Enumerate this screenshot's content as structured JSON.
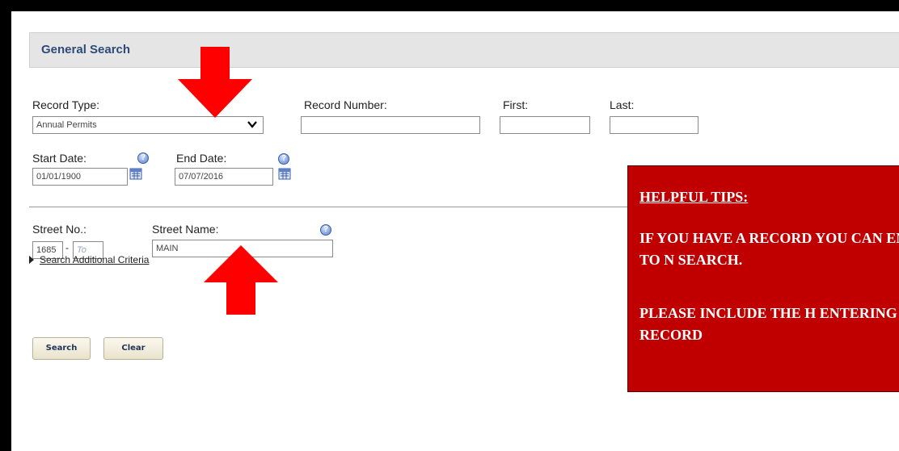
{
  "general_search": {
    "title": "General Search"
  },
  "record_type": {
    "label": "Record Type:",
    "value": "Annual Permits"
  },
  "record_number": {
    "label": "Record Number:",
    "value": ""
  },
  "first": {
    "label": "First:",
    "value": ""
  },
  "last": {
    "label": "Last:",
    "value": ""
  },
  "start_date": {
    "label": "Start Date:",
    "value": "01/01/1900"
  },
  "end_date": {
    "label": "End Date:",
    "value": "07/07/2016"
  },
  "street_no": {
    "label": "Street No.:",
    "from": "1685",
    "to_placeholder": "To",
    "separator": "-"
  },
  "street_name": {
    "label": "Street Name:",
    "value": "MAIN"
  },
  "additional": {
    "label": "Search Additional Criteria"
  },
  "buttons": {
    "search": "Search",
    "clear": "Clear"
  },
  "help_glyph": "?",
  "tips": {
    "title": "HELPFUL TIPS:",
    "p1": "IF YOU HAVE A RECORD YOU CAN ENTER IT TO N SEARCH.",
    "p2": "PLEASE INCLUDE THE H ENTERING THE RECORD"
  },
  "colors": {
    "header_text": "#2d4a78",
    "tips_bg": "#c00000",
    "arrow": "#ff0000",
    "frame": "#000000"
  },
  "icons": [
    "help-icon",
    "calendar-icon",
    "chevron-down-icon",
    "expand-triangle-icon",
    "red-arrow-down",
    "red-arrow-up"
  ]
}
